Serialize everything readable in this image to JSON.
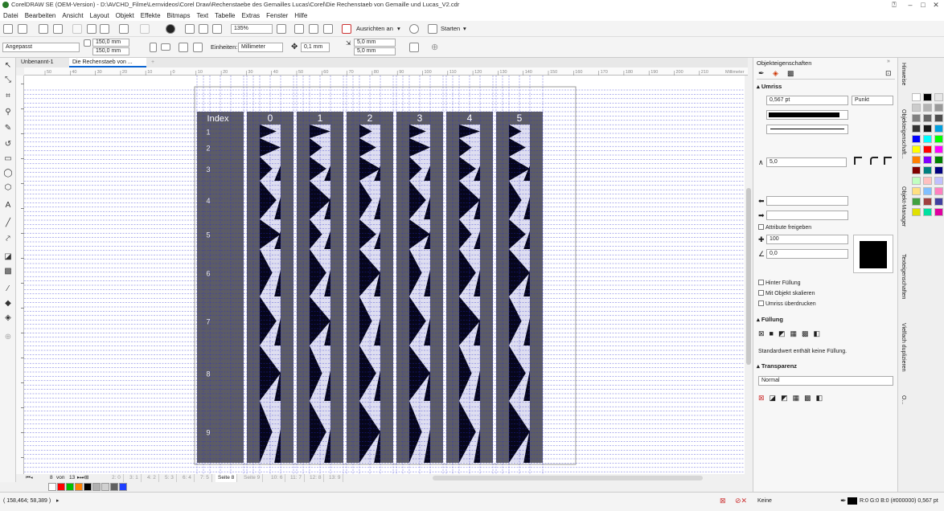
{
  "title_bar": {
    "text": "CorelDRAW SE (OEM-Version) - D:\\AVCHD_Filme\\Lernvideos\\Corel Draw\\Rechenstaebe des Gemailles Lucas\\Corel\\Die Rechenstaeb von Gemaille und Lucas_V2.cdr"
  },
  "menu": [
    "Datei",
    "Bearbeiten",
    "Ansicht",
    "Layout",
    "Objekt",
    "Effekte",
    "Bitmaps",
    "Text",
    "Tabelle",
    "Extras",
    "Fenster",
    "Hilfe"
  ],
  "toolbar1": {
    "zoom": "135%",
    "snap_label": "Ausrichten an",
    "launch_label": "Starten"
  },
  "toolbar2": {
    "preset": "Angepasst",
    "width": "150,0 mm",
    "height": "150,0 mm",
    "units_label": "Einheiten:",
    "units": "Millimeter",
    "nudge": "0,1 mm",
    "dup_x": "5,0 mm",
    "dup_y": "5,0 mm"
  },
  "doc_tabs": [
    "Unbenannt-1",
    "Die Rechenstaeb von ..."
  ],
  "ruler_unit": "Millimeter",
  "ruler_ticks": [
    "50",
    "40",
    "30",
    "20",
    "10",
    "0",
    "10",
    "20",
    "30",
    "40",
    "50",
    "60",
    "70",
    "80",
    "90",
    "100",
    "110",
    "120",
    "130",
    "140",
    "150",
    "160",
    "170",
    "180",
    "190",
    "200",
    "210"
  ],
  "rods": {
    "header_labels": [
      "Index",
      "0",
      "1",
      "2",
      "3",
      "4",
      "5"
    ],
    "index_labels": [
      "1",
      "2",
      "3",
      "4",
      "5",
      "6",
      "7",
      "8",
      "9"
    ]
  },
  "pages": {
    "current": "8",
    "of_label": "von",
    "total": "13",
    "tabs": [
      "2: 0",
      "3: 1",
      "4: 2",
      "5: 3",
      "6: 4",
      "7: 5",
      "Seite 8",
      "Seite 9",
      "10: 6",
      "11: 7",
      "12: 8",
      "13: 9"
    ]
  },
  "status": {
    "coords": "( 158,464; 58,389 )",
    "fill": "Keine",
    "outline": "R:0 G:0 B:0 (#000000)  0,567 pt"
  },
  "docker": {
    "title": "Objekteigenschaften",
    "outline_title": "Umriss",
    "outline_width": "0,567 pt",
    "outline_unit": "Punkt",
    "miter": "5,0",
    "share_attr": "Attribute freigeben",
    "stretch": "100",
    "angle": "0,0",
    "behind_fill": "Hinter Füllung",
    "scale_obj": "Mit Objekt skalieren",
    "overprint": "Umriss überdrucken",
    "fill_title": "Füllung",
    "fill_note": "Standardwert enthält keine Füllung.",
    "transp_title": "Transparenz",
    "transp_mode": "Normal"
  },
  "side_tabs": [
    "Hinweise",
    "Objekteigenschaft...",
    "Objekt-Manager",
    "Texteigenschaften",
    "Vielfach duplizieren",
    "O..."
  ],
  "colors": {
    "rod": "#5c5c66",
    "rod_light": "#dedef0",
    "triangle": "#06061a",
    "guide": "#2b2bd0",
    "accent": "#0a64d2"
  },
  "palette_colors": [
    "#ffffff",
    "#000000",
    "#e6e6e6",
    "#cccccc",
    "#b3b3b3",
    "#999999",
    "#808080",
    "#666666",
    "#4d4d4d",
    "#333333",
    "#1a1a1a",
    "#00a0e0",
    "#0000ff",
    "#00ffff",
    "#00ff00",
    "#ffff00",
    "#ff0000",
    "#ff00ff",
    "#ff8000",
    "#8000ff",
    "#008000",
    "#800000",
    "#008080",
    "#000080",
    "#c0ffc0",
    "#ffc0c0",
    "#c0c0ff",
    "#ffe080",
    "#80c0ff",
    "#ff80c0",
    "#40a040",
    "#a04040",
    "#4040a0",
    "#e0e000",
    "#00e0a0",
    "#e000a0"
  ],
  "bottom_palette": [
    "#ffffff",
    "#ff0000",
    "#00c000",
    "#ff8000",
    "#000000",
    "#b0b0b0",
    "#d0d0d0",
    "#606060",
    "#2040ff"
  ]
}
